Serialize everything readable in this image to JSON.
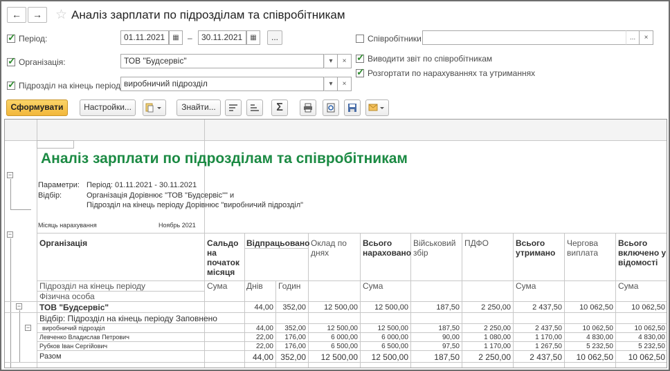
{
  "window": {
    "title": "Аналіз зарплати по підрозділам та співробітникам",
    "back_icon": "←",
    "forward_icon": "→",
    "star_icon": "☆"
  },
  "filters": {
    "period_label": "Період:",
    "period_from": "01.11.2021",
    "period_to": "30.11.2021",
    "period_dash": "–",
    "org_label": "Організація:",
    "org_value": "ТОВ \"Будсервіс\"",
    "dept_label": "Підрозділ на кінець періоду:",
    "dept_value": "виробничий підрозділ",
    "employees_label": "Співробітники:",
    "employees_value": "",
    "by_employees_label": "Виводити звіт по співробітникам",
    "expand_label": "Розгортати по нарахуваннях та утриманнях",
    "ellipsis": "...",
    "clear": "×",
    "dropdown": "▾",
    "calendar": "▦"
  },
  "toolbar": {
    "generate": "Сформувати",
    "settings": "Настройки...",
    "find": "Знайти...",
    "sum": "Σ"
  },
  "report": {
    "title": "Аналіз зарплати по підрозділам та співробітникам",
    "params_label": "Параметри:",
    "params_value": "Період: 01.11.2021 - 30.11.2021",
    "filter_label": "Відбір:",
    "filter_line1": "Організація Дорівнює \"ТОВ \"Будсервіс\"\" и",
    "filter_line2": "Підрозділ на кінець періоду Дорівнює \"виробничий підрозділ\"",
    "month_label": "Місяць нарахування",
    "month_value": "Ноябрь 2021",
    "headers": {
      "org": "Організація",
      "dept": "Підрозділ на кінець періоду",
      "person": "Фізична особа",
      "saldo": "Сальдо на початок місяця",
      "saldo_sub": "Сума",
      "worked": "Відпрацьовано",
      "days": "Днів",
      "hours": "Годин",
      "salary": "Оклад по днях",
      "accrued": "Всього нараховано",
      "accrued_sub": "Сума",
      "military": "Військовий збір",
      "pdfo": "ПДФО",
      "withheld": "Всього утримано",
      "withheld_sub": "Сума",
      "payment": "Чергова виплата",
      "included": "Всього включено у відомості",
      "included_sub": "Сума"
    },
    "rows": [
      {
        "label": "ТОВ \"Будсервіс\"",
        "days": "44,00",
        "hours": "352,00",
        "salary": "12 500,00",
        "accrued": "12 500,00",
        "military": "187,50",
        "pdfo": "2 250,00",
        "withheld": "2 437,50",
        "payment": "10 062,50",
        "included": "10 062,50"
      },
      {
        "label": "Відбір: Підрозділ на кінець періоду Заповнено"
      },
      {
        "label": "виробничий підрозділ",
        "days": "44,00",
        "hours": "352,00",
        "salary": "12 500,00",
        "accrued": "12 500,00",
        "military": "187,50",
        "pdfo": "2 250,00",
        "withheld": "2 437,50",
        "payment": "10 062,50",
        "included": "10 062,50"
      },
      {
        "label": "Левченко Владислав Петрович",
        "days": "22,00",
        "hours": "176,00",
        "salary": "6 000,00",
        "accrued": "6 000,00",
        "military": "90,00",
        "pdfo": "1 080,00",
        "withheld": "1 170,00",
        "payment": "4 830,00",
        "included": "4 830,00"
      },
      {
        "label": "Рубков Іван Сергійович",
        "days": "22,00",
        "hours": "176,00",
        "salary": "6 500,00",
        "accrued": "6 500,00",
        "military": "97,50",
        "pdfo": "1 170,00",
        "withheld": "1 267,50",
        "payment": "5 232,50",
        "included": "5 232,50"
      },
      {
        "label": "Разом",
        "days": "44,00",
        "hours": "352,00",
        "salary": "12 500,00",
        "accrued": "12 500,00",
        "military": "187,50",
        "pdfo": "2 250,00",
        "withheld": "2 437,50",
        "payment": "10 062,50",
        "included": "10 062,50"
      }
    ]
  }
}
